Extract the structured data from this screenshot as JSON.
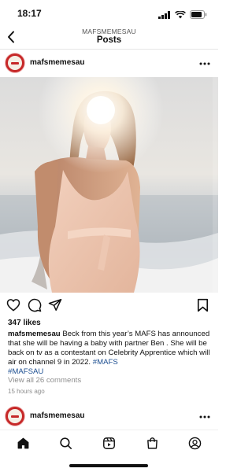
{
  "status_bar": {
    "time": "18:17"
  },
  "header": {
    "account": "MAFSMEMESAU",
    "title": "Posts"
  },
  "post": {
    "username": "mafsmemesau",
    "likes": "347 likes",
    "caption_user": "mafsmemesau",
    "caption_text": " Beck from this year’s  MAFS has announced that she will be having a baby with partner Ben . She will be back on tv as a contestant on Celebrity Apprentice which will air on channel 9 in 2022. ",
    "hashtag_1": "#MAFS",
    "hashtag_2": "#MAFSAU",
    "view_comments": "View all 26 comments",
    "time_ago": "15 hours ago"
  },
  "next_post": {
    "username": "mafsmemesau"
  },
  "icons": {
    "back": "chevron-left-icon",
    "more": "more-horizontal-icon",
    "like": "heart-icon",
    "comment": "comment-icon",
    "share": "send-icon",
    "save": "bookmark-icon",
    "home": "home-icon",
    "search": "search-icon",
    "reels": "reels-icon",
    "shop": "shop-icon",
    "profile": "profile-icon"
  },
  "colors": {
    "link": "#1d4f91",
    "muted": "#8e8e8e",
    "avatar": "#c62828"
  }
}
